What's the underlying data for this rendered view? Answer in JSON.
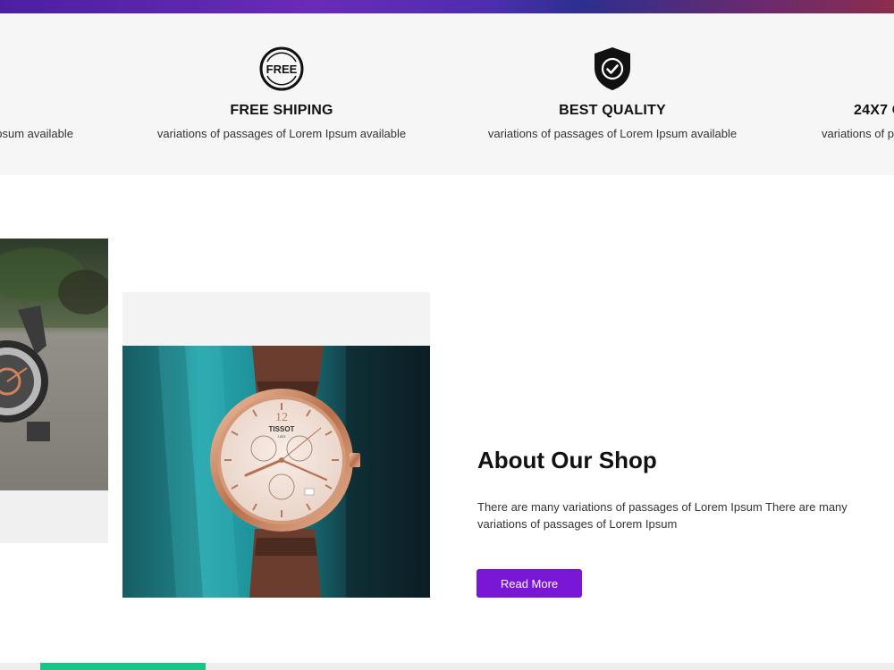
{
  "features": [
    {
      "title": "",
      "desc": "psum available",
      "icon": "truck-icon"
    },
    {
      "title": "FREE SHIPING",
      "desc": "variations of passages of Lorem Ipsum available",
      "icon": "free-badge-icon",
      "badge": "FREE"
    },
    {
      "title": "BEST QUALITY",
      "desc": "variations of passages of Lorem Ipsum available",
      "icon": "shield-check-icon"
    },
    {
      "title": "24X7 C",
      "desc": "variations of p",
      "icon": "support-icon"
    }
  ],
  "about": {
    "title": "About Our Shop",
    "text": "There are many variations of passages of Lorem Ipsum There are many variations of passages of Lorem Ipsum",
    "button": "Read More"
  },
  "watch": {
    "brand": "TISSOT",
    "year": "1853",
    "numeral": "12"
  },
  "colors": {
    "accent": "#7a16d6",
    "progress": "#17c785",
    "panel": "#f6f6f6"
  }
}
